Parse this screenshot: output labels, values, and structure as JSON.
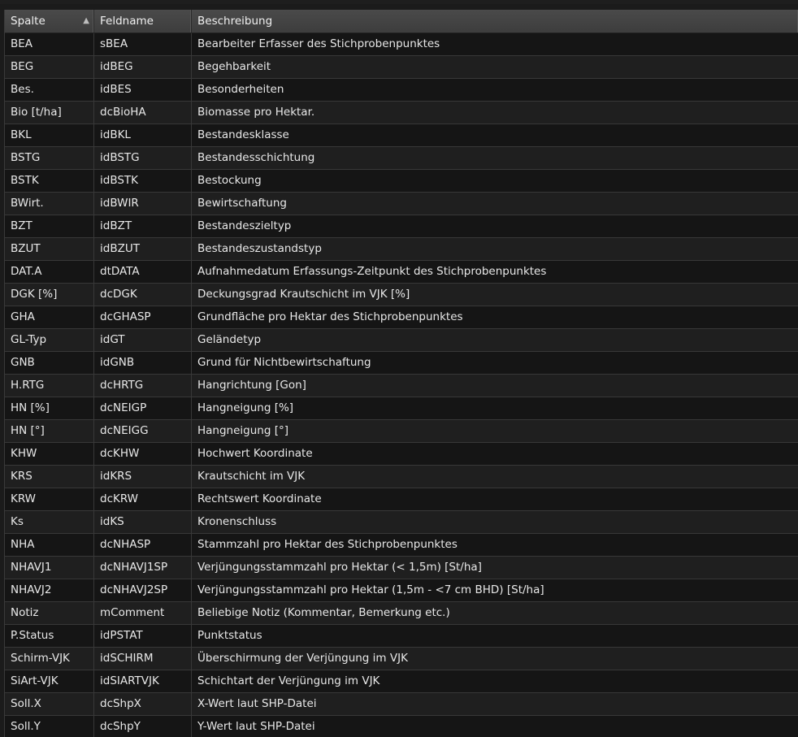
{
  "table": {
    "columns": [
      {
        "key": "spalte",
        "label": "Spalte",
        "sort": "ascending",
        "sort_icon": "▲"
      },
      {
        "key": "feldname",
        "label": "Feldname"
      },
      {
        "key": "beschreibung",
        "label": "Beschreibung"
      }
    ],
    "rows": [
      [
        "BEA",
        "sBEA",
        "Bearbeiter Erfasser des Stichprobenpunktes"
      ],
      [
        "BEG",
        "idBEG",
        "Begehbarkeit"
      ],
      [
        "Bes.",
        "idBES",
        "Besonderheiten"
      ],
      [
        "Bio [t/ha]",
        "dcBioHA",
        "Biomasse pro Hektar."
      ],
      [
        "BKL",
        "idBKL",
        "Bestandesklasse"
      ],
      [
        "BSTG",
        "idBSTG",
        "Bestandesschichtung"
      ],
      [
        "BSTK",
        "idBSTK",
        "Bestockung"
      ],
      [
        "BWirt.",
        "idBWIR",
        "Bewirtschaftung"
      ],
      [
        "BZT",
        "idBZT",
        "Bestandeszieltyp"
      ],
      [
        "BZUT",
        "idBZUT",
        "Bestandeszustandstyp"
      ],
      [
        "DAT.A",
        "dtDATA",
        "Aufnahmedatum Erfassungs-Zeitpunkt des Stichprobenpunktes"
      ],
      [
        "DGK [%]",
        "dcDGK",
        "Deckungsgrad Krautschicht im VJK [%]"
      ],
      [
        "GHA",
        "dcGHASP",
        "Grundfläche pro Hektar des Stichprobenpunktes"
      ],
      [
        "GL-Typ",
        "idGT",
        "Geländetyp"
      ],
      [
        "GNB",
        "idGNB",
        "Grund für Nichtbewirtschaftung"
      ],
      [
        "H.RTG",
        "dcHRTG",
        "Hangrichtung [Gon]"
      ],
      [
        "HN [%]",
        "dcNEIGP",
        "Hangneigung [%]"
      ],
      [
        "HN [°]",
        "dcNEIGG",
        "Hangneigung [°]"
      ],
      [
        "KHW",
        "dcKHW",
        "Hochwert Koordinate"
      ],
      [
        "KRS",
        "idKRS",
        "Krautschicht im VJK"
      ],
      [
        "KRW",
        "dcKRW",
        "Rechtswert Koordinate"
      ],
      [
        "Ks",
        "idKS",
        "Kronenschluss"
      ],
      [
        "NHA",
        "dcNHASP",
        "Stammzahl pro Hektar des Stichprobenpunktes"
      ],
      [
        "NHAVJ1",
        "dcNHAVJ1SP",
        "Verjüngungsstammzahl pro Hektar (< 1,5m) [St/ha]"
      ],
      [
        "NHAVJ2",
        "dcNHAVJ2SP",
        "Verjüngungsstammzahl pro Hektar (1,5m - <7 cm BHD) [St/ha]"
      ],
      [
        "Notiz",
        "mComment",
        "Beliebige Notiz (Kommentar, Bemerkung etc.)"
      ],
      [
        "P.Status",
        "idPSTAT",
        "Punktstatus"
      ],
      [
        "Schirm-VJK",
        "idSCHIRM",
        "Überschirmung der Verjüngung im VJK"
      ],
      [
        "SiArt-VJK",
        "idSIARTVJK",
        "Schichtart der Verjüngung im VJK"
      ],
      [
        "Soll.X",
        "dcShpX",
        "X-Wert laut SHP-Datei"
      ],
      [
        "Soll.Y",
        "dcShpY",
        "Y-Wert laut SHP-Datei"
      ]
    ]
  }
}
